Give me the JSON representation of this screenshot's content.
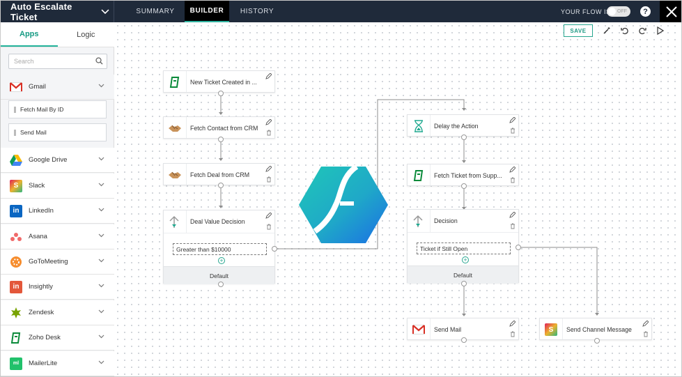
{
  "topbar": {
    "flow_name": "Auto Escalate Ticket",
    "tabs": [
      {
        "label": "SUMMARY"
      },
      {
        "label": "BUILDER"
      },
      {
        "label": "HISTORY"
      }
    ],
    "active_tab": "BUILDER",
    "flow_status_label": "YOUR FLOW IS",
    "toggle_state": "OFF",
    "help_label": "?"
  },
  "sidebar": {
    "tabs": [
      {
        "label": "Apps"
      },
      {
        "label": "Logic"
      }
    ],
    "active_tab": "Apps",
    "search_placeholder": "Search",
    "apps": [
      {
        "label": "Gmail",
        "icon": "gmail-icon",
        "expanded": true,
        "actions": [
          {
            "label": "Fetch Mail By ID"
          },
          {
            "label": "Send Mail"
          }
        ]
      },
      {
        "label": "Google Drive",
        "icon": "google-drive-icon"
      },
      {
        "label": "Slack",
        "icon": "slack-icon"
      },
      {
        "label": "LinkedIn",
        "icon": "linkedin-icon"
      },
      {
        "label": "Asana",
        "icon": "asana-icon"
      },
      {
        "label": "GoToMeeting",
        "icon": "gotomeeting-icon"
      },
      {
        "label": "Insightly",
        "icon": "insightly-icon"
      },
      {
        "label": "Zendesk",
        "icon": "zendesk-icon"
      },
      {
        "label": "Zoho Desk",
        "icon": "zoho-desk-icon"
      },
      {
        "label": "MailerLite",
        "icon": "mailerlite-icon"
      }
    ]
  },
  "toolbar": {
    "save_label": "SAVE"
  },
  "flow": {
    "left": {
      "trigger": "New Ticket Created in ...",
      "fetch_contact": "Fetch Contact from CRM",
      "fetch_deal": "Fetch Deal from CRM",
      "decision": {
        "label": "Deal Value Decision",
        "condition": "Greater than $10000",
        "default_label": "Default"
      }
    },
    "right": {
      "delay": "Delay the Action",
      "fetch_ticket": "Fetch Ticket from Supp...",
      "decision": {
        "label": "Decision",
        "condition": "Ticket if Still Open",
        "default_label": "Default"
      },
      "send_mail": "Send Mail",
      "send_channel": "Send Channel Message"
    }
  },
  "colors": {
    "topbar": "#1f2a3a",
    "accent": "#22b39b",
    "canvas_dot": "#cfd3d8"
  }
}
